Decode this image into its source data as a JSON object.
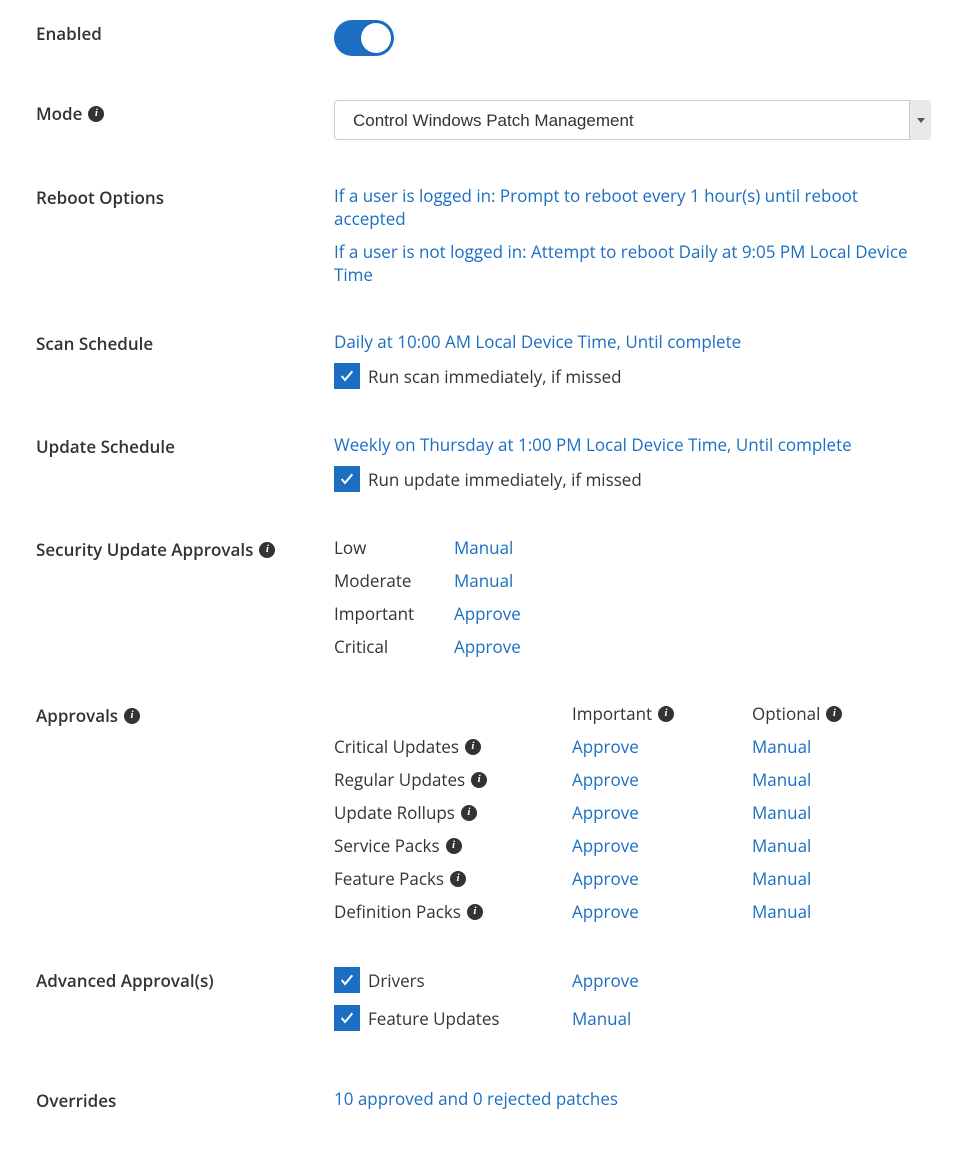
{
  "labels": {
    "enabled": "Enabled",
    "mode": "Mode",
    "reboot": "Reboot Options",
    "scan": "Scan Schedule",
    "update": "Update Schedule",
    "sec_approvals": "Security Update Approvals",
    "approvals": "Approvals",
    "adv_approvals": "Advanced Approval(s)",
    "overrides": "Overrides"
  },
  "mode": {
    "selected": "Control Windows Patch Management"
  },
  "reboot": {
    "logged_in": "If a user is logged in: Prompt to reboot every 1 hour(s) until reboot accepted",
    "not_logged_in": "If a user is not logged in: Attempt to reboot Daily at 9:05 PM Local Device Time"
  },
  "scan": {
    "schedule": "Daily at 10:00 AM Local Device Time, Until complete",
    "run_if_missed": "Run scan immediately, if missed"
  },
  "update": {
    "schedule": "Weekly on Thursday at 1:00 PM Local Device Time, Until complete",
    "run_if_missed": "Run update immediately, if missed"
  },
  "sec_approvals": {
    "rows": [
      {
        "level": "Low",
        "action": "Manual"
      },
      {
        "level": "Moderate",
        "action": "Manual"
      },
      {
        "level": "Important",
        "action": "Approve"
      },
      {
        "level": "Critical",
        "action": "Approve"
      }
    ]
  },
  "approvals": {
    "headers": {
      "important": "Important",
      "optional": "Optional"
    },
    "rows": [
      {
        "name": "Critical Updates",
        "important": "Approve",
        "optional": "Manual"
      },
      {
        "name": "Regular Updates",
        "important": "Approve",
        "optional": "Manual"
      },
      {
        "name": "Update Rollups",
        "important": "Approve",
        "optional": "Manual"
      },
      {
        "name": "Service Packs",
        "important": "Approve",
        "optional": "Manual"
      },
      {
        "name": "Feature Packs",
        "important": "Approve",
        "optional": "Manual"
      },
      {
        "name": "Definition Packs",
        "important": "Approve",
        "optional": "Manual"
      }
    ]
  },
  "adv_approvals": {
    "rows": [
      {
        "name": "Drivers",
        "action": "Approve"
      },
      {
        "name": "Feature Updates",
        "action": "Manual"
      }
    ]
  },
  "overrides": {
    "summary": "10 approved and 0 rejected patches"
  }
}
